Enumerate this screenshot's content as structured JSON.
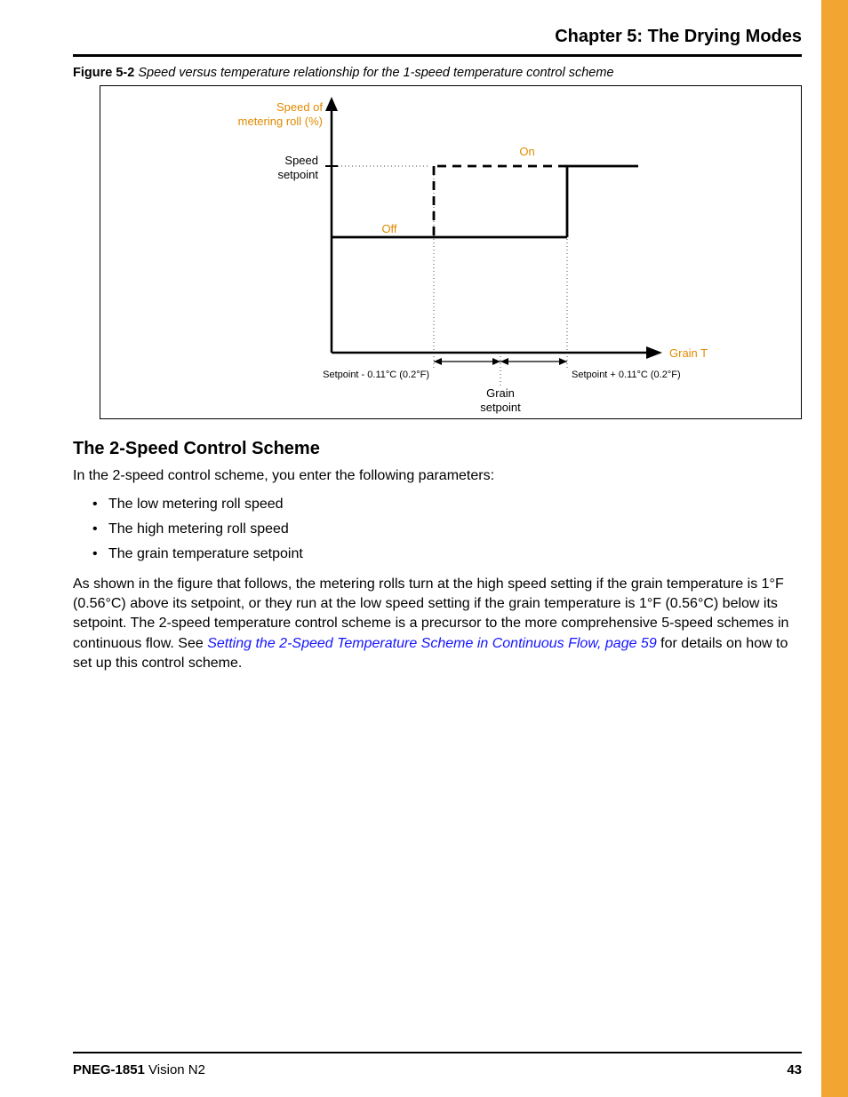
{
  "header": {
    "chapter_title": "Chapter 5: The Drying Modes"
  },
  "figure": {
    "label": "Figure 5-2",
    "caption": "Speed versus temperature relationship for the 1-speed temperature control scheme",
    "labels": {
      "y_axis_line1": "Speed of",
      "y_axis_line2": "metering roll (%)",
      "x_axis": "Grain T",
      "speed_setpoint_line1": "Speed",
      "speed_setpoint_line2": "setpoint",
      "on": "On",
      "off": "Off",
      "tick_left": "Setpoint - 0.11°C (0.2°F)",
      "tick_right": "Setpoint + 0.11°C (0.2°F)",
      "grain_setpoint_line1": "Grain",
      "grain_setpoint_line2": "setpoint"
    }
  },
  "section": {
    "heading": "The 2-Speed Control Scheme",
    "intro": "In the 2-speed control scheme, you enter the following parameters:",
    "bullets": [
      "The low metering roll speed",
      "The high metering roll speed",
      "The grain temperature setpoint"
    ],
    "para_before_link": "As shown in the figure that follows, the  metering rolls turn at the high speed setting if the grain temperature is 1°F (0.56°C) above its setpoint, or they run at the low speed setting if the grain temperature is 1°F (0.56°C) below its setpoint. The 2-speed temperature control scheme is a precursor to the more comprehensive 5-speed schemes in continuous flow. See ",
    "link_text": "Setting the 2-Speed Temperature Scheme in Continuous Flow, page 59",
    "para_after_link": " for details on how to set up this control scheme."
  },
  "footer": {
    "doc_id": "PNEG-1851",
    "doc_title": "Vision N2",
    "page_number": "43"
  },
  "chart_data": {
    "type": "line",
    "title": "Speed versus temperature relationship for the 1-speed temperature control scheme",
    "xlabel": "Grain T",
    "ylabel": "Speed of metering roll (%)",
    "x_reference_points": {
      "hysteresis_low": "Setpoint - 0.11°C (0.2°F)",
      "center": "Grain setpoint",
      "hysteresis_high": "Setpoint + 0.11°C (0.2°F)"
    },
    "y_reference_points": {
      "off": "Off",
      "on": "Speed setpoint"
    },
    "series": [
      {
        "name": "rising_temperature",
        "path": "Off until Setpoint+0.11°C then step up to Speed setpoint (On)"
      },
      {
        "name": "falling_temperature",
        "path": "On until Setpoint-0.11°C then step down to Off",
        "style": "dashed"
      }
    ],
    "notes": "Hysteresis band = ±0.11°C (±0.2°F) around grain temperature setpoint"
  }
}
